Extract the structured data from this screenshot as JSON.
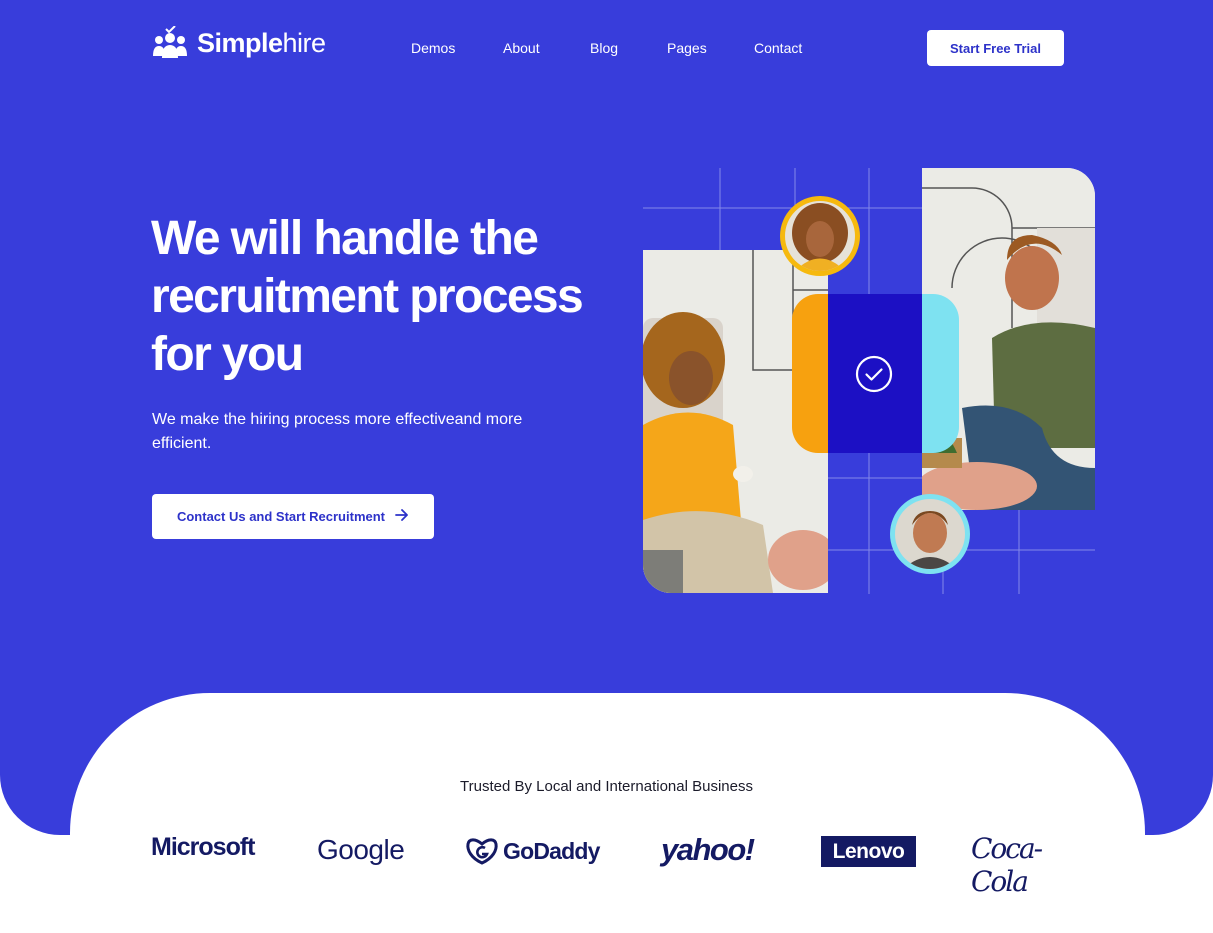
{
  "header": {
    "logo_bold": "Simple",
    "logo_light": "hire",
    "nav": [
      "Demos",
      "About",
      "Blog",
      "Pages",
      "Contact"
    ],
    "cta": "Start Free Trial"
  },
  "hero": {
    "headline": "We will handle the recruitment process for you",
    "subtext": "We make the hiring process more effectiveand more efficient.",
    "cta": "Contact Us and Start Recruitment",
    "cta_icon": "arrow-right-icon"
  },
  "trusted": {
    "title": "Trusted By Local and International Business",
    "logos": [
      "Microsoft",
      "Google",
      "GoDaddy",
      "yahoo!",
      "Lenovo",
      "Coca-Cola"
    ]
  },
  "colors": {
    "primary": "#383ddb",
    "accent_orange": "#f7a10f",
    "accent_cyan": "#7ee2f1",
    "accent_navy": "#1c10c4",
    "logo_navy": "#141a63"
  }
}
